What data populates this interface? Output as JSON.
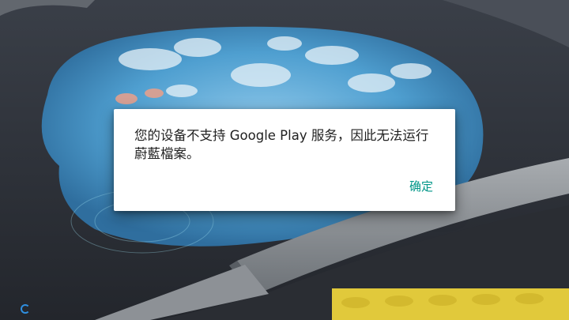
{
  "dialog": {
    "message": "您的设备不支持 Google Play 服务，因此无法运行蔚藍檔案。",
    "confirm_label": "确定"
  },
  "colors": {
    "accent": "#009688",
    "loading_indicator": "#2f8fe0"
  },
  "icons": {
    "loading": "loading-spinner-icon"
  }
}
